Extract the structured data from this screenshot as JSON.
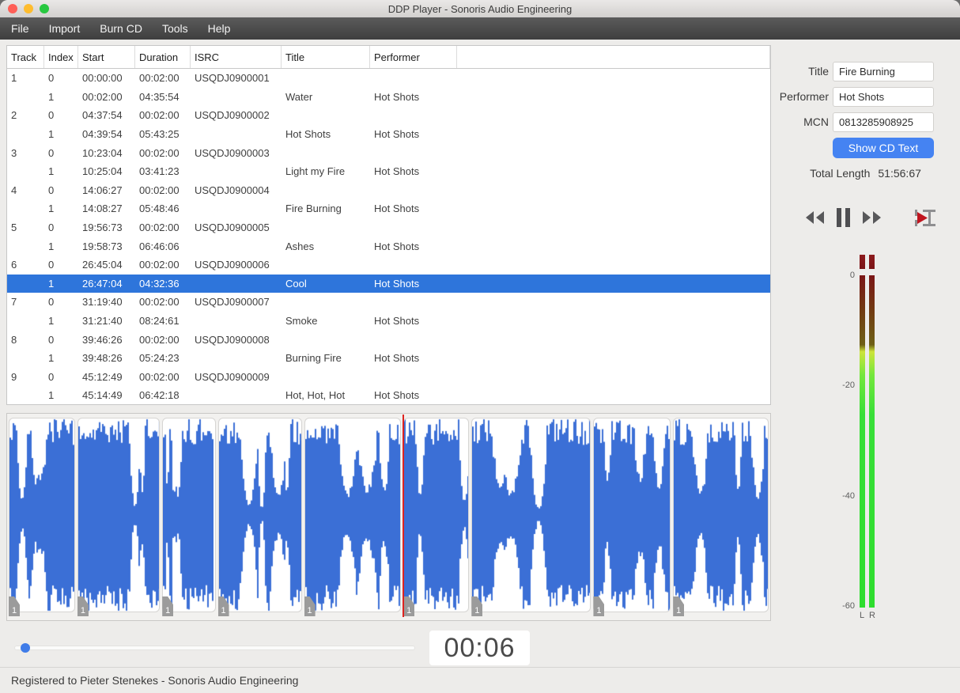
{
  "window": {
    "title": "DDP Player - Sonoris Audio Engineering"
  },
  "menu": {
    "items": [
      "File",
      "Import",
      "Burn CD",
      "Tools",
      "Help"
    ]
  },
  "track_table": {
    "columns": [
      "Track",
      "Index",
      "Start",
      "Duration",
      "ISRC",
      "Title",
      "Performer"
    ],
    "rows": [
      {
        "track": "1",
        "index": "0",
        "start": "00:00:00",
        "duration": "00:02:00",
        "isrc": "USQDJ0900001",
        "title": "",
        "performer": "",
        "selected": false
      },
      {
        "track": "",
        "index": "1",
        "start": "00:02:00",
        "duration": "04:35:54",
        "isrc": "",
        "title": "Water",
        "performer": "Hot Shots",
        "selected": false
      },
      {
        "track": "2",
        "index": "0",
        "start": "04:37:54",
        "duration": "00:02:00",
        "isrc": "USQDJ0900002",
        "title": "",
        "performer": "",
        "selected": false
      },
      {
        "track": "",
        "index": "1",
        "start": "04:39:54",
        "duration": "05:43:25",
        "isrc": "",
        "title": "Hot Shots",
        "performer": "Hot Shots",
        "selected": false
      },
      {
        "track": "3",
        "index": "0",
        "start": "10:23:04",
        "duration": "00:02:00",
        "isrc": "USQDJ0900003",
        "title": "",
        "performer": "",
        "selected": false
      },
      {
        "track": "",
        "index": "1",
        "start": "10:25:04",
        "duration": "03:41:23",
        "isrc": "",
        "title": "Light my Fire",
        "performer": "Hot Shots",
        "selected": false
      },
      {
        "track": "4",
        "index": "0",
        "start": "14:06:27",
        "duration": "00:02:00",
        "isrc": "USQDJ0900004",
        "title": "",
        "performer": "",
        "selected": false
      },
      {
        "track": "",
        "index": "1",
        "start": "14:08:27",
        "duration": "05:48:46",
        "isrc": "",
        "title": "Fire Burning",
        "performer": "Hot Shots",
        "selected": false
      },
      {
        "track": "5",
        "index": "0",
        "start": "19:56:73",
        "duration": "00:02:00",
        "isrc": "USQDJ0900005",
        "title": "",
        "performer": "",
        "selected": false
      },
      {
        "track": "",
        "index": "1",
        "start": "19:58:73",
        "duration": "06:46:06",
        "isrc": "",
        "title": "Ashes",
        "performer": "Hot Shots",
        "selected": false
      },
      {
        "track": "6",
        "index": "0",
        "start": "26:45:04",
        "duration": "00:02:00",
        "isrc": "USQDJ0900006",
        "title": "",
        "performer": "",
        "selected": false
      },
      {
        "track": "",
        "index": "1",
        "start": "26:47:04",
        "duration": "04:32:36",
        "isrc": "",
        "title": "Cool",
        "performer": "Hot Shots",
        "selected": true
      },
      {
        "track": "7",
        "index": "0",
        "start": "31:19:40",
        "duration": "00:02:00",
        "isrc": "USQDJ0900007",
        "title": "",
        "performer": "",
        "selected": false
      },
      {
        "track": "",
        "index": "1",
        "start": "31:21:40",
        "duration": "08:24:61",
        "isrc": "",
        "title": "Smoke",
        "performer": "Hot Shots",
        "selected": false
      },
      {
        "track": "8",
        "index": "0",
        "start": "39:46:26",
        "duration": "00:02:00",
        "isrc": "USQDJ0900008",
        "title": "",
        "performer": "",
        "selected": false
      },
      {
        "track": "",
        "index": "1",
        "start": "39:48:26",
        "duration": "05:24:23",
        "isrc": "",
        "title": "Burning Fire",
        "performer": "Hot Shots",
        "selected": false
      },
      {
        "track": "9",
        "index": "0",
        "start": "45:12:49",
        "duration": "00:02:00",
        "isrc": "USQDJ0900009",
        "title": "",
        "performer": "",
        "selected": false
      },
      {
        "track": "",
        "index": "1",
        "start": "45:14:49",
        "duration": "06:42:18",
        "isrc": "",
        "title": "Hot, Hot, Hot",
        "performer": "Hot Shots",
        "selected": false
      }
    ]
  },
  "cd_text_panel": {
    "title_label": "Title",
    "title_value": "Fire Burning",
    "performer_label": "Performer",
    "performer_value": "Hot Shots",
    "mcn_label": "MCN",
    "mcn_value": "0813285908925",
    "show_cd_text_button": "Show CD Text",
    "total_length_label": "Total Length",
    "total_length_value": "51:56:67"
  },
  "transport": {
    "buttons": [
      "rewind-icon",
      "pause-icon",
      "fast-forward-icon",
      "play-marker-icon"
    ]
  },
  "meters": {
    "scale": [
      "0",
      "-20",
      "-40",
      "-60"
    ],
    "channels": [
      "L",
      "R"
    ],
    "level_pct": 78
  },
  "waveform": {
    "segments": [
      {
        "track": 1,
        "marker": "1",
        "width_pct": 8.9
      },
      {
        "track": 2,
        "marker": "1",
        "width_pct": 11.1
      },
      {
        "track": 3,
        "marker": "1",
        "width_pct": 7.1
      },
      {
        "track": 4,
        "marker": "1",
        "width_pct": 11.3
      },
      {
        "track": 5,
        "marker": "1",
        "width_pct": 13.1
      },
      {
        "track": 6,
        "marker": "1",
        "width_pct": 8.8
      },
      {
        "track": 7,
        "marker": "1",
        "width_pct": 16.2
      },
      {
        "track": 8,
        "marker": "1",
        "width_pct": 10.4
      },
      {
        "track": 9,
        "marker": "1",
        "width_pct": 12.9
      }
    ],
    "playhead_pct": 51.8
  },
  "player": {
    "time_display": "00:06",
    "slider_pct": 2.8
  },
  "status_bar": {
    "text": "Registered to Pieter Stenekes - Sonoris Audio Engineering"
  },
  "colors": {
    "selection": "#2e75db",
    "waveform": "#3b6fd6",
    "accent_button": "#4583f2",
    "playhead": "#dd2420",
    "meter_green": "#2edd2e",
    "meter_red": "#7b1516"
  }
}
